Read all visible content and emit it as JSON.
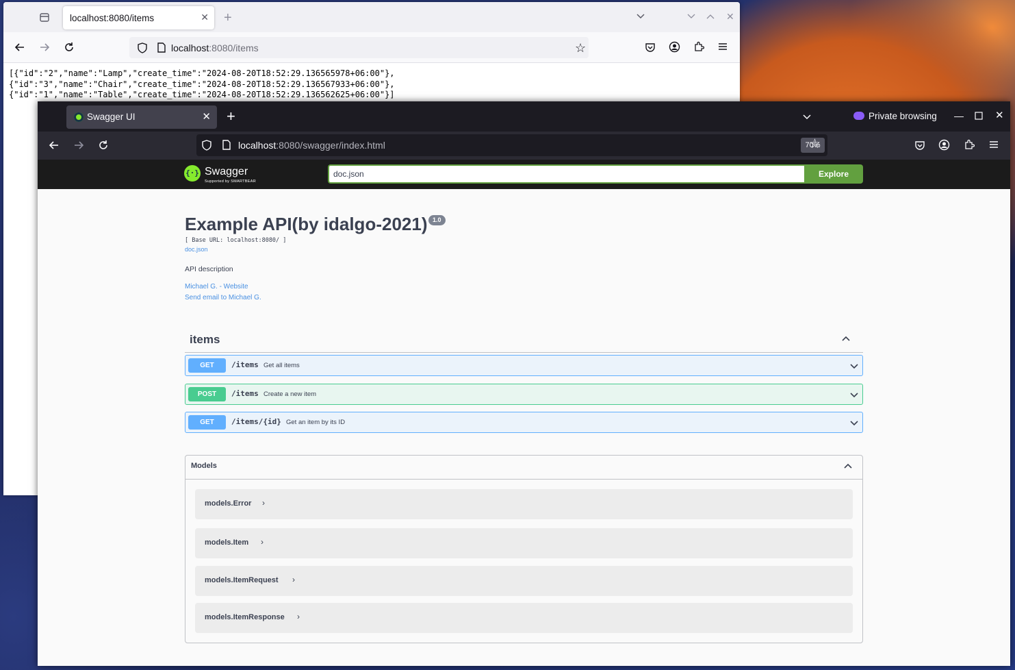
{
  "back_window": {
    "tab_title": "localhost:8080/items",
    "url_host": "localhost",
    "url_path": ":8080/items",
    "body_lines": [
      "[{\"id\":\"2\",\"name\":\"Lamp\",\"create_time\":\"2024-08-20T18:52:29.136565978+06:00\"},",
      "{\"id\":\"3\",\"name\":\"Chair\",\"create_time\":\"2024-08-20T18:52:29.136567933+06:00\"},",
      "{\"id\":\"1\",\"name\":\"Table\",\"create_time\":\"2024-08-20T18:52:29.136562625+06:00\"}]"
    ]
  },
  "front_window": {
    "tab_title": "Swagger UI",
    "private_label": "Private browsing",
    "url_host": "localhost",
    "url_path": ":8080/swagger/index.html",
    "zoom": "70%"
  },
  "swagger": {
    "logo_text": "Swagger",
    "logo_sub": "Supported by SMARTBEAR",
    "spec_url": "doc.json",
    "explore_label": "Explore",
    "title": "Example API(by idalgo-2021)",
    "version": "1.0",
    "base_url": "[ Base URL: localhost:8080/ ]",
    "spec_link": "doc.json",
    "description": "API description",
    "contact_website": "Michael G. - Website",
    "contact_email": "Send email to Michael G.",
    "tag": "items",
    "operations": [
      {
        "method": "GET",
        "path": "/items",
        "summary": "Get all items"
      },
      {
        "method": "POST",
        "path": "/items",
        "summary": "Create a new item"
      },
      {
        "method": "GET",
        "path": "/items/{id}",
        "summary": "Get an item by its ID"
      }
    ],
    "models_title": "Models",
    "models": [
      "models.Error",
      "models.Item",
      "models.ItemRequest",
      "models.ItemResponse"
    ]
  },
  "colors": {
    "get": "#61affe",
    "post": "#49cc90",
    "explore": "#62a03f"
  }
}
